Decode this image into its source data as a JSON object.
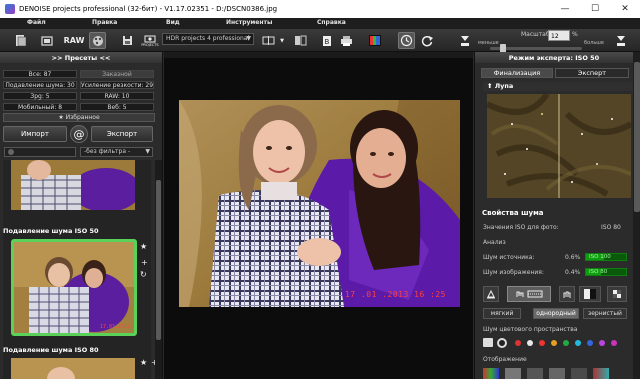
{
  "window": {
    "title": "DENOISE projects professional (32-бит) - V1.17.02351 - D:/DSCN0386.jpg",
    "minimize": "—",
    "maximize": "☐",
    "close": "✕"
  },
  "menu": [
    "Файл",
    "Правка",
    "Вид",
    "Инструменты",
    "Справка"
  ],
  "toolbar": {
    "raw_label": "RAW",
    "projects_label": "PROJECTS",
    "preset_select": "HDR projects 4 professional",
    "zoom_label": "Масштаб",
    "zoom_value": "12",
    "zoom_unit": "%",
    "zoom_less": "меньше",
    "zoom_more": "больше"
  },
  "left": {
    "header": ">> Пресеты <<",
    "stats": [
      {
        "label": "Все: 87"
      },
      {
        "label": "Заказной"
      },
      {
        "label": "Подавление шума: 30"
      },
      {
        "label": "Усиление резкости: 29"
      },
      {
        "label": "Зрg: 5"
      },
      {
        "label": "RAW: 10"
      },
      {
        "label": "Мобильный: 8"
      },
      {
        "label": "Веб: 5"
      }
    ],
    "favorites": "★ Избранное",
    "import_btn": "Импорт",
    "at_btn": "@",
    "export_btn": "Экспорт",
    "filter_value": "-без фильтра -",
    "presets": [
      {
        "label": "Подавление шума ISO 50"
      },
      {
        "label": "Подавление шума ISO 80"
      }
    ]
  },
  "main": {
    "date_stamp": "17 .01 .2013  16 :25"
  },
  "right": {
    "header": "Режим эксперта: ISO 50",
    "tabs": [
      "Финализация",
      "Эксперт"
    ],
    "loupe": "Лупа",
    "props_title": "Свойства шума",
    "iso_label": "Значения ISO для фото:",
    "iso_value": "ISO 80",
    "analysis": "Анализ",
    "src_noise_label": "Шум источника:",
    "src_noise_pct": "0.6%",
    "src_noise_val": "ISO 100",
    "src_noise_level": 0.45,
    "img_noise_label": "Шум изображения:",
    "img_noise_pct": "0.4%",
    "img_noise_val": "ISO 80",
    "img_noise_level": 0.38,
    "segments": [
      "мягкий",
      "однородный",
      "зернистый"
    ],
    "color_noise_label": "Шум цветового пространства",
    "display_label": "Отображение",
    "dot_colors": [
      "#d33",
      "#e8e8e8",
      "#e33",
      "#e6a020",
      "#2a4",
      "#2bd",
      "#36d",
      "#b4d",
      "#c3b"
    ]
  }
}
